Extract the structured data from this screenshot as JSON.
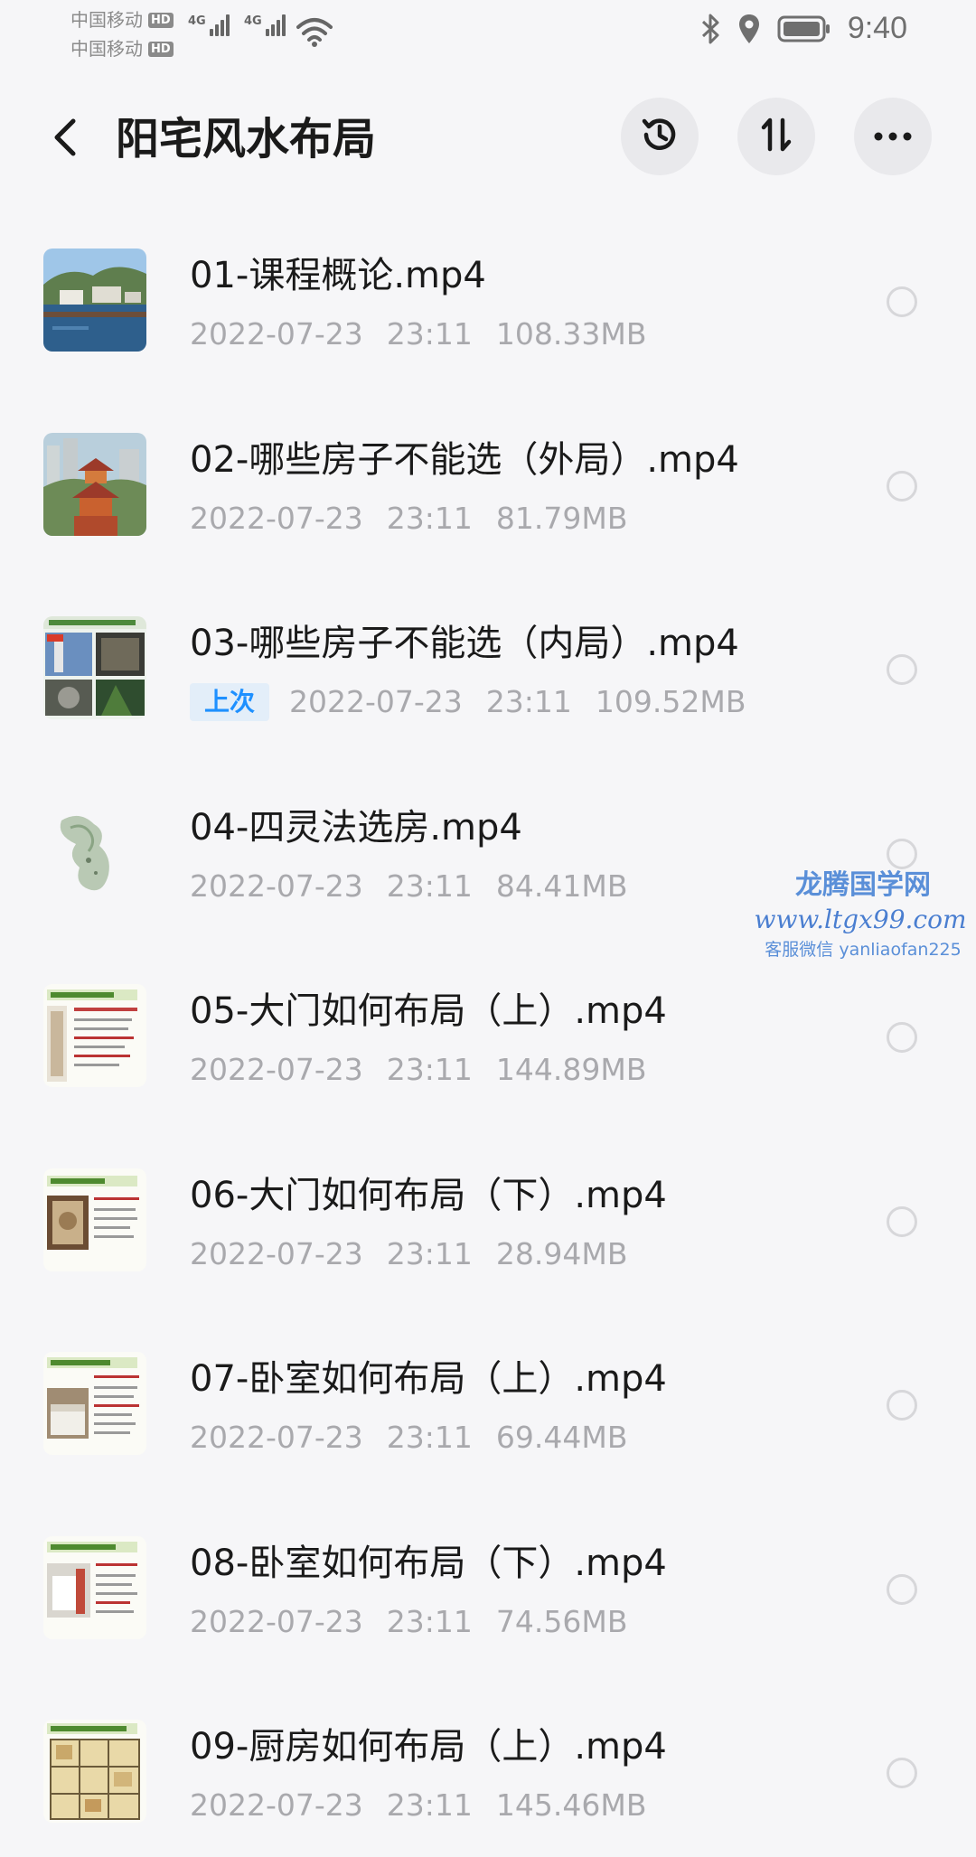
{
  "status_bar": {
    "carrier1": "中国移动",
    "carrier2": "中国移动",
    "hd": "HD",
    "network1": "4G",
    "network2": "4G",
    "time": "9:40"
  },
  "header": {
    "title": "阳宅风水布局",
    "back_icon": "back-arrow-icon",
    "history_icon": "history-icon",
    "sort_icon": "sort-icon",
    "more_icon": "more-dots-icon"
  },
  "files": [
    {
      "name": "01-课程概论.mp4",
      "date": "2022-07-23",
      "time": "23:11",
      "size": "108.33MB",
      "badge": ""
    },
    {
      "name": "02-哪些房子不能选（外局）.mp4",
      "date": "2022-07-23",
      "time": "23:11",
      "size": "81.79MB",
      "badge": ""
    },
    {
      "name": "03-哪些房子不能选（内局）.mp4",
      "date": "2022-07-23",
      "time": "23:11",
      "size": "109.52MB",
      "badge": "上次"
    },
    {
      "name": "04-四灵法选房.mp4",
      "date": "2022-07-23",
      "time": "23:11",
      "size": "84.41MB",
      "badge": ""
    },
    {
      "name": "05-大门如何布局（上）.mp4",
      "date": "2022-07-23",
      "time": "23:11",
      "size": "144.89MB",
      "badge": ""
    },
    {
      "name": "06-大门如何布局（下）.mp4",
      "date": "2022-07-23",
      "time": "23:11",
      "size": "28.94MB",
      "badge": ""
    },
    {
      "name": "07-卧室如何布局（上）.mp4",
      "date": "2022-07-23",
      "time": "23:11",
      "size": "69.44MB",
      "badge": ""
    },
    {
      "name": "08-卧室如何布局（下）.mp4",
      "date": "2022-07-23",
      "time": "23:11",
      "size": "74.56MB",
      "badge": ""
    },
    {
      "name": "09-厨房如何布局（上）.mp4",
      "date": "2022-07-23",
      "time": "23:11",
      "size": "145.46MB",
      "badge": ""
    }
  ],
  "watermark": {
    "title": "龙腾国学网",
    "url": "www.ltgx99.com",
    "contact": "客服微信 yanliaofan225"
  },
  "colors": {
    "background": "#f6f6f8",
    "badge_text": "#1e90ff",
    "badge_bg": "#e3eef9",
    "meta_text": "#a9a9ad"
  }
}
